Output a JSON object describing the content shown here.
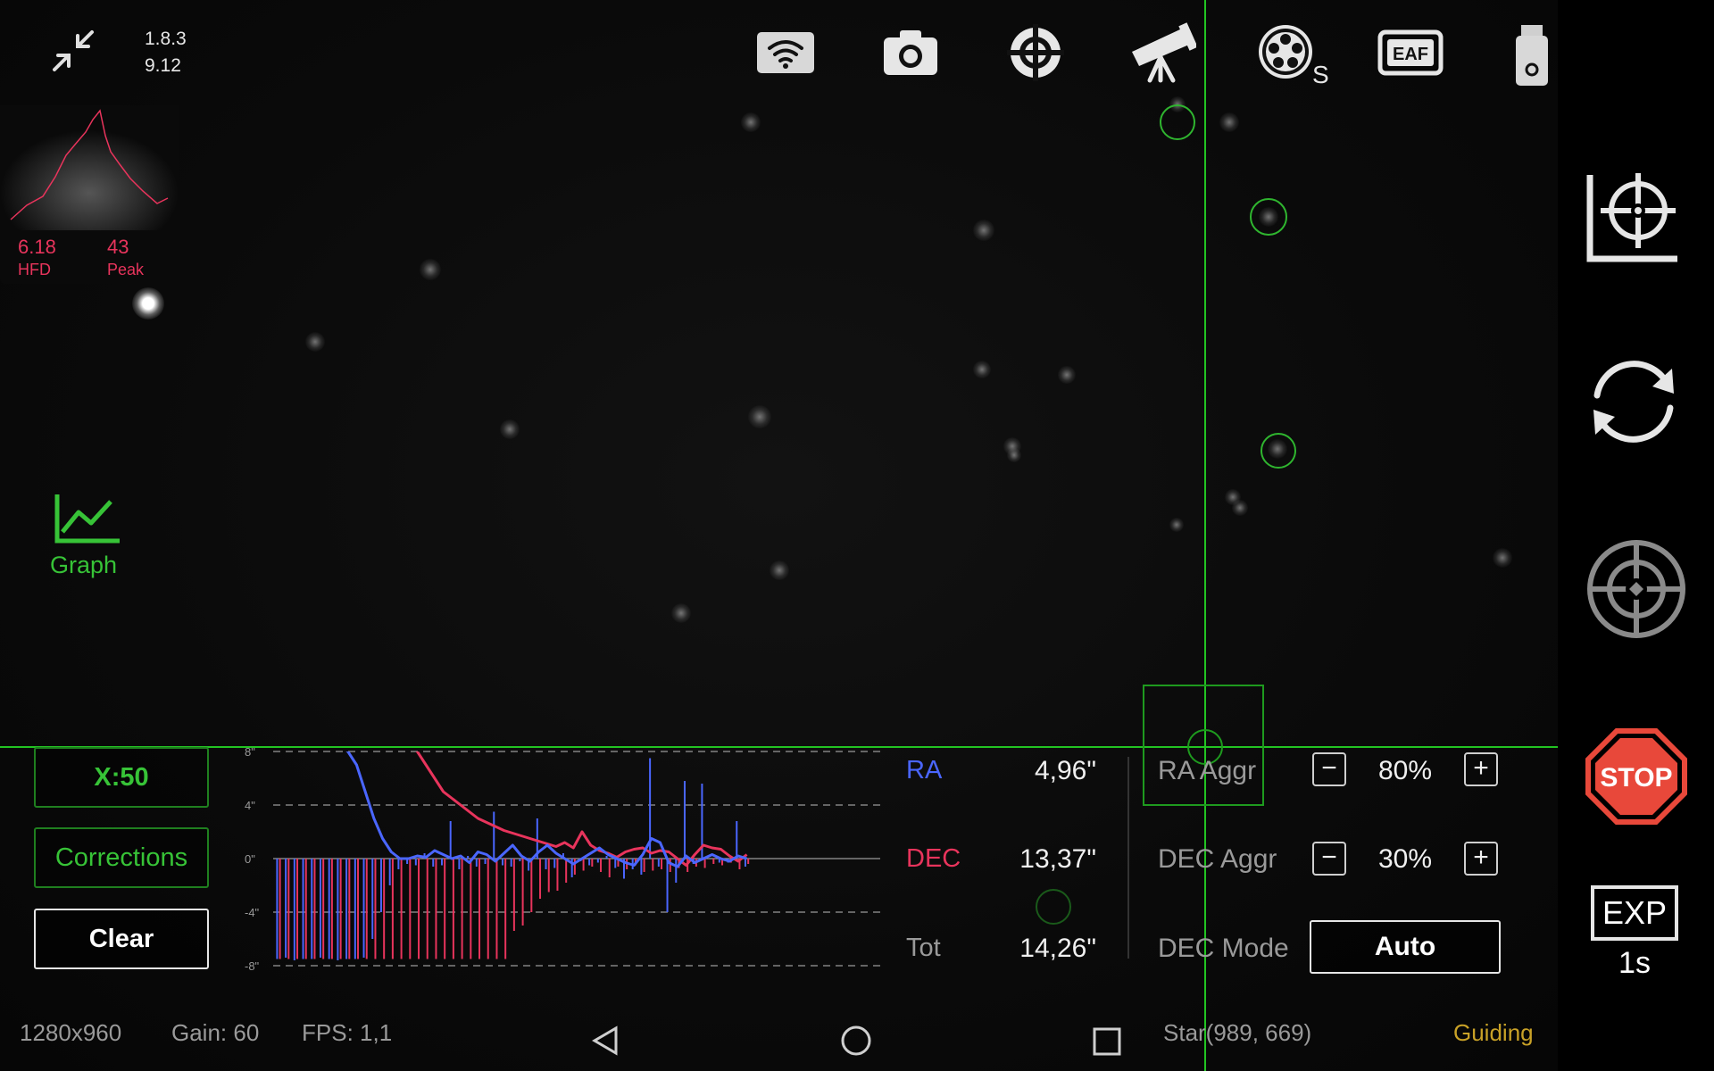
{
  "app": {
    "version": "1.8.3",
    "sub_version": "9.12"
  },
  "histogram": {
    "hfd_value": "6.18",
    "hfd_label": "HFD",
    "peak_value": "43",
    "peak_label": "Peak"
  },
  "top_icons": [
    "wifi-icon",
    "camera-icon",
    "focuser-icon",
    "telescope-icon",
    "filter-wheel-icon",
    "eaf-icon",
    "usb-drive-icon",
    "info-icon"
  ],
  "filter_wheel_badge": "S",
  "eaf_label": "EAF",
  "graph_button": {
    "label": "Graph"
  },
  "left_controls": {
    "scale": "X:50",
    "corrections": "Corrections",
    "clear": "Clear"
  },
  "chart_data": {
    "type": "line",
    "y_ticks": [
      "8\"",
      "4\"",
      "0\"",
      "-4\"",
      "-8\""
    ],
    "ylim": [
      -8,
      8
    ],
    "x": [
      0,
      1,
      2,
      3,
      4,
      5,
      6,
      7,
      8,
      9,
      10,
      11,
      12,
      13,
      14,
      15,
      16,
      17,
      18,
      19,
      20,
      21,
      22,
      23,
      24,
      25,
      26,
      27,
      28,
      29,
      30,
      31,
      32,
      33,
      34,
      35,
      36,
      37,
      38,
      39,
      40,
      41,
      42,
      43,
      44,
      45,
      46,
      47,
      48,
      49,
      50,
      51,
      52,
      53,
      54,
      55,
      56,
      57,
      58,
      59,
      60,
      61,
      62,
      63,
      64,
      65,
      66,
      67,
      68,
      69
    ],
    "series": [
      {
        "name": "RA",
        "color": "#4a66ff",
        "values": [
          12,
          11.5,
          11,
          10.5,
          10,
          9.5,
          9,
          8.5,
          8,
          7,
          5,
          3,
          1.5,
          0.5,
          0,
          0,
          0.2,
          0.1,
          0.6,
          0.3,
          0,
          0.2,
          -0.3,
          0.5,
          0.3,
          -0.2,
          0.4,
          1,
          0.2,
          -0.2,
          0.5,
          1,
          0.4,
          0,
          -0.4,
          0,
          0.4,
          0.8,
          0.3,
          0,
          -0.3,
          -0.5,
          0.3,
          1.5,
          1.2,
          -0.3,
          -0.6,
          0.2,
          -0.3,
          0,
          0.3,
          0,
          -0.2,
          0.2,
          0,
          null,
          null,
          null,
          null,
          null,
          null,
          null,
          null,
          null,
          null,
          null,
          null,
          null,
          null,
          null
        ],
        "bars": [
          -7.5,
          -7.4,
          -7.6,
          -7.5,
          -7.5,
          -7.4,
          -7.5,
          -7.6,
          -7.5,
          -7.5,
          -7.4,
          -6,
          -4,
          -2,
          -0.8,
          -0.4,
          -0.5,
          0.4,
          -0.6,
          -0.5,
          2.8,
          -0.8,
          0.2,
          -0.6,
          -0.4,
          3.5,
          -0.5,
          -0.6,
          -0.2,
          -0.9,
          3,
          -0.8,
          -0.7,
          0.4,
          -1.4,
          -0.2,
          -0.5,
          -0.3,
          0.2,
          -0.7,
          -1.5,
          -0.8,
          -1.2,
          7.5,
          -0.6,
          -4,
          -1.8,
          5.8,
          -0.4,
          5.6,
          0,
          -0.3,
          -0.3,
          2.8,
          -0.6,
          null,
          null,
          null,
          null,
          null,
          null,
          null,
          null,
          null,
          null,
          null,
          null,
          null,
          null,
          null
        ]
      },
      {
        "name": "DEC",
        "color": "#e8345c",
        "values": [
          24,
          23,
          22,
          21,
          20,
          19,
          18,
          17,
          16,
          15,
          14,
          13,
          12,
          11,
          10,
          9,
          8,
          7,
          6,
          5,
          4.5,
          4,
          3.5,
          3,
          2.7,
          2.4,
          2.1,
          1.9,
          1.7,
          1.5,
          1.3,
          1.1,
          0.9,
          1.2,
          0.8,
          2,
          1,
          0.6,
          0.4,
          0.1,
          0.5,
          0.7,
          0.8,
          0.4,
          0.6,
          0.5,
          0,
          -0.5,
          0.3,
          1,
          0.8,
          0.7,
          0.2,
          -0.2,
          0.3,
          null,
          null,
          null,
          null,
          null,
          null,
          null,
          null,
          null,
          null,
          null,
          null,
          null,
          null,
          null
        ],
        "bars": [
          -7.5,
          -7.5,
          -7.5,
          -7.5,
          -7.5,
          -7.5,
          -7.5,
          -7.5,
          -7.5,
          -7.5,
          -7.5,
          -7.5,
          -7.5,
          -7.5,
          -7.5,
          -7.5,
          -7.5,
          -7.5,
          -7.5,
          -7.5,
          -7.5,
          -7.5,
          -7.5,
          -7.5,
          -7.5,
          -7.5,
          -7.5,
          -5.4,
          -5,
          -4,
          -3,
          -2.5,
          -2.4,
          -1.8,
          -1.2,
          -0.9,
          -0.6,
          -1,
          -1.4,
          -0.6,
          -0.8,
          -0.5,
          -1,
          -0.9,
          -0.8,
          -1,
          -0.7,
          -1,
          -0.6,
          -0.7,
          -0.4,
          -0.5,
          -0.3,
          -0.8,
          -0.4,
          null,
          null,
          null,
          null,
          null,
          null,
          null,
          null,
          null,
          null,
          null,
          null,
          null,
          null,
          null
        ]
      }
    ]
  },
  "stats": {
    "ra_label": "RA",
    "ra_value": "4,96\"",
    "dec_label": "DEC",
    "dec_value": "13,37\"",
    "tot_label": "Tot",
    "tot_value": "14,26\""
  },
  "aggr": {
    "ra_label": "RA Aggr",
    "ra_value": "80%",
    "dec_label": "DEC Aggr",
    "dec_value": "30%",
    "dec_mode_label": "DEC Mode",
    "dec_mode_value": "Auto",
    "minus": "−",
    "plus": "+"
  },
  "right_controls": {
    "stop_label": "STOP",
    "exp_label": "EXP",
    "exp_value": "1s"
  },
  "status_bar": {
    "resolution": "1280x960",
    "gain": "Gain: 60",
    "fps": "FPS: 1,1",
    "star": "Star(989, 669)",
    "state": "Guiding"
  },
  "colors": {
    "accent_green": "#37c337",
    "ra_blue": "#4a66ff",
    "dec_red": "#e8345c",
    "stop_red": "#e8483a",
    "guiding_gold": "#c9a227"
  }
}
